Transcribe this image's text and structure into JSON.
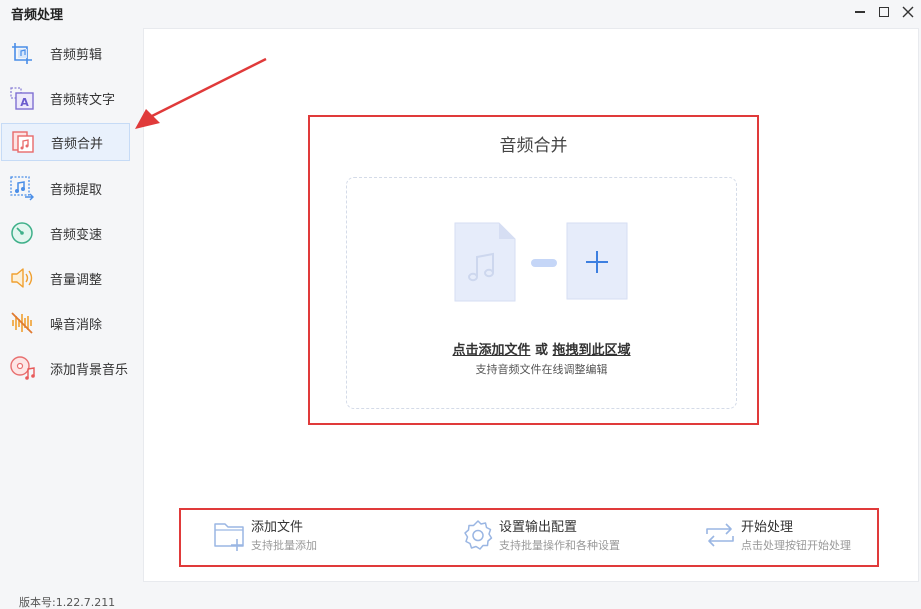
{
  "app": {
    "title": "音频处理",
    "version": "版本号:1.22.7.211"
  },
  "sidebar": {
    "items": [
      {
        "label": "音频剪辑",
        "icon": "audio-cut-icon"
      },
      {
        "label": "音频转文字",
        "icon": "audio-to-text-icon"
      },
      {
        "label": "音频合并",
        "icon": "audio-merge-icon",
        "active": true
      },
      {
        "label": "音频提取",
        "icon": "audio-extract-icon"
      },
      {
        "label": "音频变速",
        "icon": "audio-speed-icon"
      },
      {
        "label": "音量调整",
        "icon": "volume-icon"
      },
      {
        "label": "噪音消除",
        "icon": "noise-reduce-icon"
      },
      {
        "label": "添加背景音乐",
        "icon": "background-music-icon"
      }
    ]
  },
  "panel": {
    "title": "音频合并",
    "drop": {
      "add_link": "点击添加文件",
      "or": " 或 ",
      "drag_link": "拖拽到此区域",
      "sub": "支持音频文件在线调整编辑"
    }
  },
  "steps": [
    {
      "title": "添加文件",
      "desc": "支持批量添加",
      "icon": "folder-add-icon"
    },
    {
      "title": "设置输出配置",
      "desc": "支持批量操作和各种设置",
      "icon": "gear-icon"
    },
    {
      "title": "开始处理",
      "desc": "点击处理按钮开始处理",
      "icon": "repeat-icon"
    }
  ],
  "colors": {
    "accent": "#3d7fe0",
    "highlight": "#e03a3a",
    "active_bg": "#e9f1fc"
  }
}
